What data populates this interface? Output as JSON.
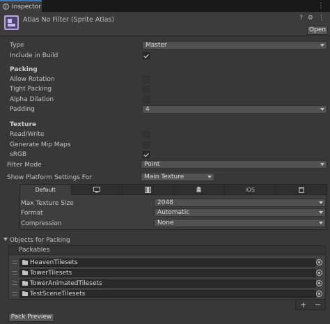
{
  "tab": {
    "label": "Inspector",
    "icon": "info-icon"
  },
  "header": {
    "title": "Atlas No Filter (Sprite Atlas)",
    "open_label": "Open",
    "help_icon": "?",
    "settings_icon": "⚙",
    "menu_icon": "⋮"
  },
  "fields": {
    "type_label": "Type",
    "type_value": "Master",
    "include_label": "Include in Build",
    "include_checked": true,
    "packing_title": "Packing",
    "allow_rotation_label": "Allow Rotation",
    "tight_packing_label": "Tight Packing",
    "alpha_dilation_label": "Alpha Dilation",
    "padding_label": "Padding",
    "padding_value": "4",
    "texture_title": "Texture",
    "readwrite_label": "Read/Write",
    "mipmaps_label": "Generate Mip Maps",
    "srgb_label": "sRGB",
    "srgb_checked": true,
    "filter_label": "Filter Mode",
    "filter_value": "Point",
    "platform_label": "Show Platform Settings For",
    "platform_value": "Main Texture"
  },
  "platform_tabs": [
    {
      "label": "Default",
      "icon": ""
    },
    {
      "label": "",
      "icon": "monitor-icon"
    },
    {
      "label": "",
      "icon": "film-icon"
    },
    {
      "label": "",
      "icon": "android-icon"
    },
    {
      "label": "iOS",
      "icon": ""
    },
    {
      "label": "",
      "icon": "trash-icon"
    }
  ],
  "platform": {
    "max_size_label": "Max Texture Size",
    "max_size_value": "2048",
    "format_label": "Format",
    "format_value": "Automatic",
    "compression_label": "Compression",
    "compression_value": "None"
  },
  "packing": {
    "title": "Objects for Packing",
    "list_header": "Packables",
    "items": [
      "HeavenTilesets",
      "TowerTilesets",
      "TowerAnimatedTilesets",
      "TestSceneTilesets"
    ],
    "add_icon": "+",
    "remove_icon": "−"
  },
  "pack_preview_label": "Pack Preview",
  "colors": {
    "accent": "#3a79bb",
    "background": "#383838",
    "field": "#515151"
  }
}
